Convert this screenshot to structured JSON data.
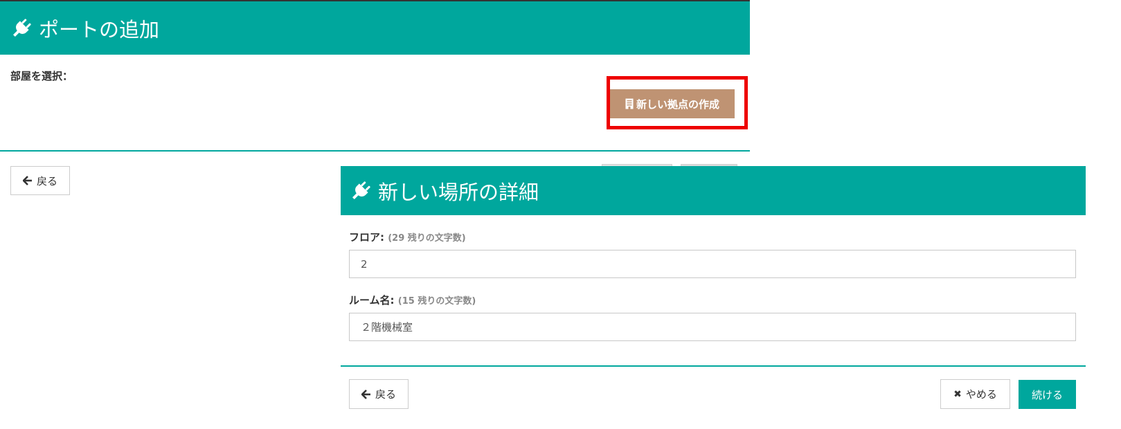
{
  "colors": {
    "header": "#00a79d",
    "accent_button": "#bf9373",
    "highlight_border": "#ee0000",
    "primary_button": "#00a79d"
  },
  "back_dialog": {
    "icon": "plug-icon",
    "title": "ポートの追加",
    "select_room_label": "部屋を選択：",
    "new_site_button": {
      "icon": "document-icon",
      "label": "新しい拠点の作成"
    },
    "back_button": {
      "icon": "arrow-left-icon",
      "label": "戻る"
    }
  },
  "front_dialog": {
    "icon": "plug-icon",
    "title": "新しい場所の詳細",
    "floor": {
      "label": "フロア:",
      "hint": "(29 残りの文字数)",
      "value": "2"
    },
    "room": {
      "label": "ルーム名:",
      "hint": "(15 残りの文字数)",
      "value": "２階機械室"
    },
    "back_button": {
      "icon": "arrow-left-icon",
      "label": "戻る"
    },
    "cancel_button": {
      "icon": "close-icon",
      "label": "やめる"
    },
    "continue_button": {
      "label": "続ける"
    }
  }
}
